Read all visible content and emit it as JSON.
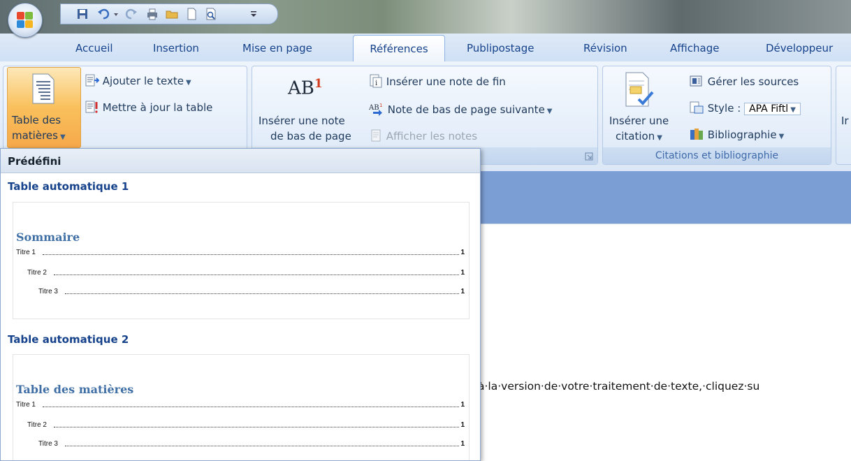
{
  "quick_access": {
    "icons": [
      "save-icon",
      "undo-icon",
      "redo-icon",
      "print-icon",
      "open-folder-icon",
      "new-document-icon",
      "print-preview-icon",
      "customize-dropdown-icon"
    ]
  },
  "tabs": [
    {
      "label": "Accueil"
    },
    {
      "label": "Insertion"
    },
    {
      "label": "Mise en page"
    },
    {
      "label": "Références"
    },
    {
      "label": "Publipostage"
    },
    {
      "label": "Révision"
    },
    {
      "label": "Affichage"
    },
    {
      "label": "Développeur"
    }
  ],
  "ribbon": {
    "toc": {
      "big_button_line1": "Table des",
      "big_button_line2": "matières",
      "add_text": "Ajouter le texte",
      "update_table": "Mettre à jour la table"
    },
    "footnotes": {
      "ab_glyph": "AB",
      "ab_sup": "1",
      "insert_line1": "Insérer une note",
      "insert_line2": "de bas de page",
      "insert_endnote": "Insérer une note de fin",
      "next_footnote": "Note de bas de page suivante",
      "show_notes": "Afficher les notes"
    },
    "citations": {
      "insert_line1": "Insérer une",
      "insert_line2": "citation",
      "manage_sources": "Gérer les sources",
      "style_label": "Style :",
      "style_value": "APA Fiftl",
      "bibliography": "Bibliographie",
      "group_label": "Citations et bibliographie"
    },
    "next_group_partial": "Ir"
  },
  "gallery": {
    "header": "Prédéfini",
    "sections": [
      {
        "title": "Table automatique 1",
        "preview_title": "Sommaire",
        "entries": [
          {
            "label": "Titre 1",
            "page": "1"
          },
          {
            "label": "Titre 2",
            "page": "1"
          },
          {
            "label": "Titre 3",
            "page": "1"
          }
        ]
      },
      {
        "title": "Table automatique 2",
        "preview_title": "Table des matières",
        "entries": [
          {
            "label": "Titre 1",
            "page": "1"
          },
          {
            "label": "Titre 2",
            "page": "1"
          },
          {
            "label": "Titre 3",
            "page": "1"
          }
        ]
      }
    ]
  },
  "document": {
    "visible_text": "à·la·version·de·votre·traitement·de·texte,·cliquez·su"
  }
}
